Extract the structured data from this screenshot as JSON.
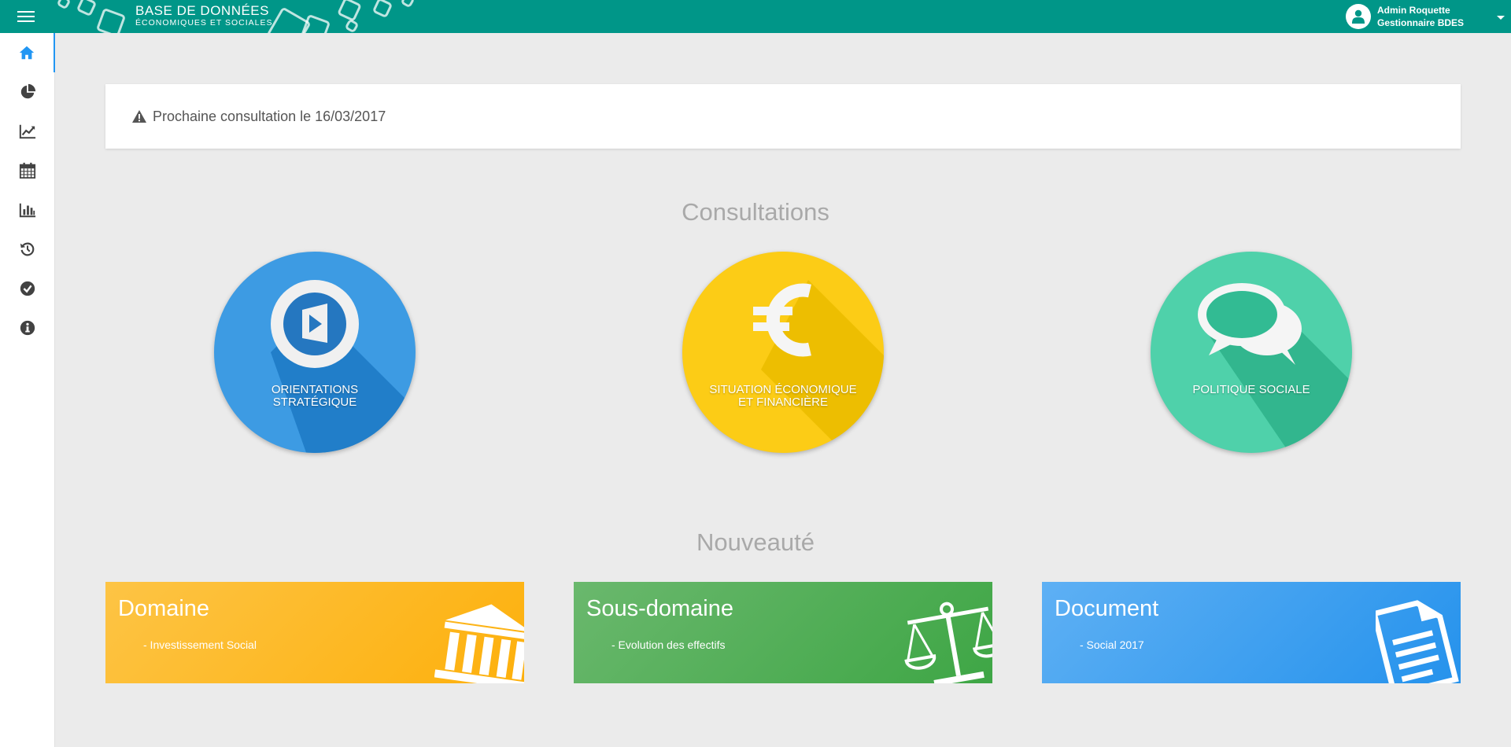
{
  "header": {
    "brand_line1": "BASE DE DONNÉES",
    "brand_line2": "ÉCONOMIQUES ET SOCIALES",
    "user_name": "Admin Roquette",
    "user_role": "Gestionnaire BDES",
    "menu_icon": "hamburger-menu-icon",
    "color": "#009688"
  },
  "sidebar": {
    "items": [
      {
        "icon": "home-icon",
        "active": true
      },
      {
        "icon": "pie-chart-icon"
      },
      {
        "icon": "line-chart-icon"
      },
      {
        "icon": "calendar-icon"
      },
      {
        "icon": "bar-chart-icon"
      },
      {
        "icon": "history-icon"
      },
      {
        "icon": "check-circle-icon"
      },
      {
        "icon": "info-icon"
      }
    ],
    "active_color": "#2196f3"
  },
  "alert": {
    "icon": "warning-icon",
    "text": "Prochaine consultation le 16/03/2017"
  },
  "consultations": {
    "title": "Consultations",
    "items": [
      {
        "line1": "ORIENTATIONS",
        "line2": "STRATÉGIQUE",
        "icon": "play-circle-icon",
        "color": "#3d9be3"
      },
      {
        "line1": "SITUATION ÉCONOMIQUE",
        "line2": "ET FINANCIÈRE",
        "icon": "euro-icon",
        "color": "#fccc16"
      },
      {
        "line1": "POLITIQUE SOCIALE",
        "line2": "",
        "icon": "chat-bubbles-icon",
        "color": "#4fd1aa"
      }
    ]
  },
  "nouveaute": {
    "title": "Nouveauté",
    "cards": [
      {
        "title": "Domaine",
        "item": "- Investissement Social",
        "icon": "institution-icon",
        "color": "#fdb514"
      },
      {
        "title": "Sous-domaine",
        "item": "- Evolution des effectifs",
        "icon": "balance-scale-icon",
        "color": "#52ab55"
      },
      {
        "title": "Document",
        "item": "- Social 2017",
        "icon": "document-icon",
        "color": "#3596ee"
      }
    ]
  }
}
